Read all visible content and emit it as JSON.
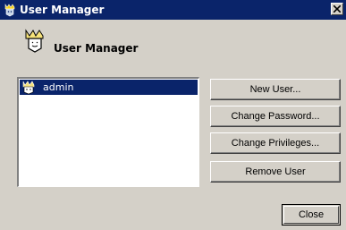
{
  "window": {
    "title": "User Manager",
    "title_icon": "user-manager-app-icon",
    "close_icon": "close-icon",
    "colors": {
      "titlebar": "#0a246a",
      "face": "#d4d0c8",
      "selection": "#0a246a"
    }
  },
  "header": {
    "title": "User Manager",
    "icon": "user-manager-icon"
  },
  "users": {
    "items": [
      {
        "label": "admin",
        "icon": "user-icon",
        "selected": true
      }
    ]
  },
  "actions": {
    "new_user": "New User...",
    "change_password": "Change Password...",
    "change_privileges": "Change Privileges...",
    "remove_user": "Remove User"
  },
  "footer": {
    "close": "Close"
  }
}
